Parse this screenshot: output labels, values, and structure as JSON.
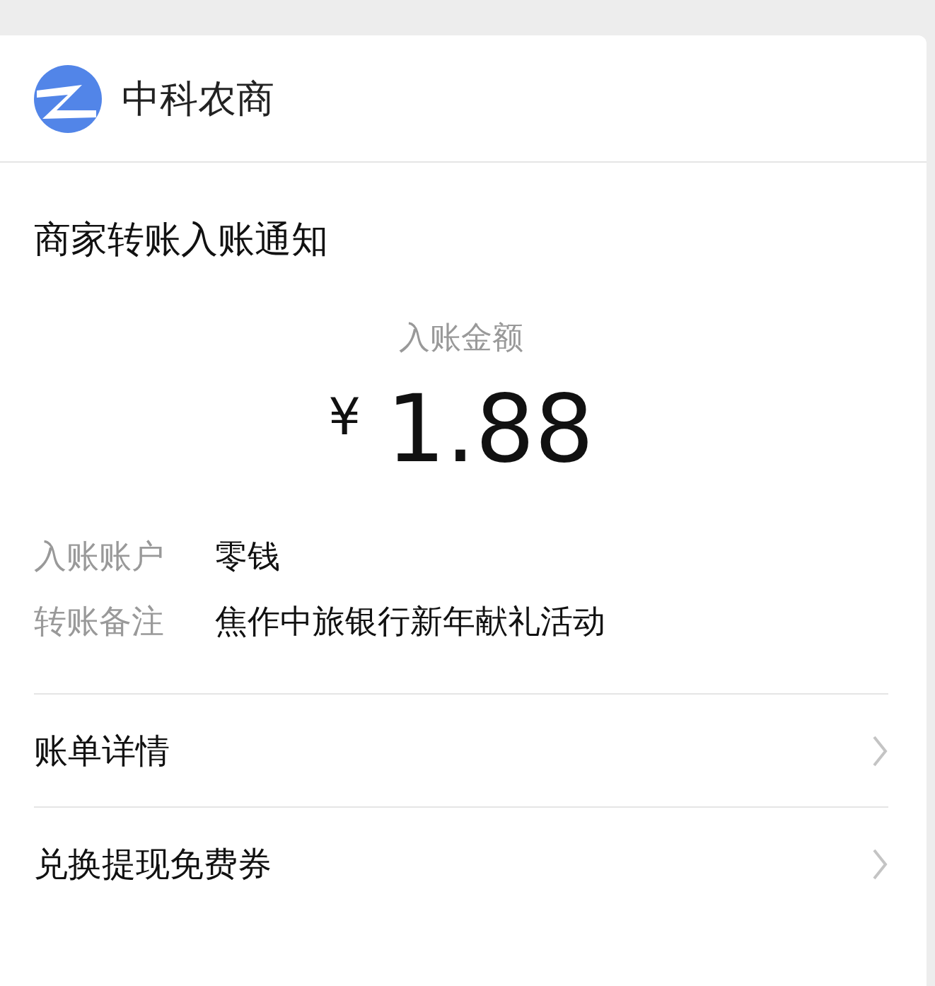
{
  "header": {
    "bank_name": "中科农商"
  },
  "notice": {
    "title": "商家转账入账通知",
    "amount_label": "入账金额",
    "currency": "¥",
    "amount": "1.88"
  },
  "details": [
    {
      "label": "入账账户",
      "value": "零钱"
    },
    {
      "label": "转账备注",
      "value": "焦作中旅银行新年献礼活动"
    }
  ],
  "links": [
    {
      "label": "账单详情"
    },
    {
      "label": "兑换提现免费券"
    }
  ]
}
